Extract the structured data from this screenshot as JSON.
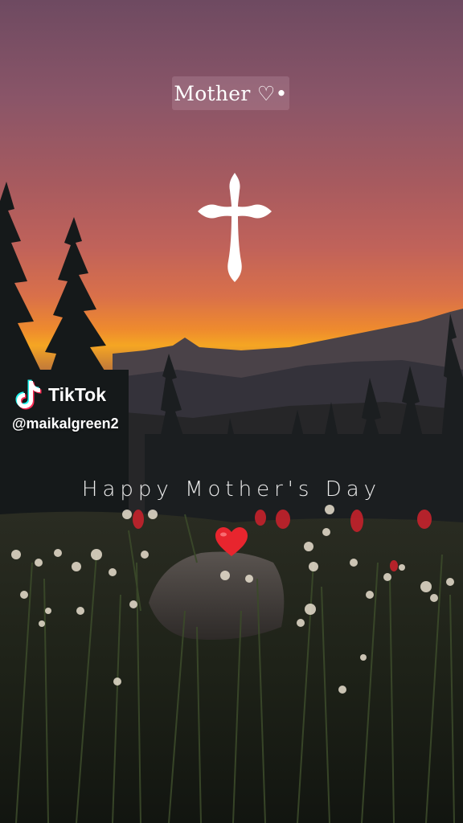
{
  "overlay": {
    "title": "Mother ♡•",
    "caption": "Happy Mother's Day"
  },
  "watermark": {
    "brand": "TikTok",
    "handle": "@maikalgreen2"
  },
  "icons": {
    "cross": "cross-icon",
    "heart": "heart-icon",
    "tiktok": "tiktok-logo-icon"
  },
  "colors": {
    "heart": "#e8252e",
    "sunset_glow": "#f5a623",
    "tiktok_cyan": "#25f4ee",
    "tiktok_red": "#fe2c55"
  }
}
